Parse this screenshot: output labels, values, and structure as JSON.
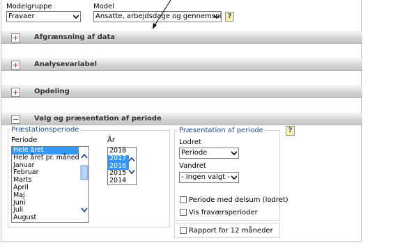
{
  "colors": {
    "accent": "#3399ff",
    "section_title": "#1f4e9a",
    "help_bg": "#fff1a8"
  },
  "top": {
    "modelgruppe_label": "Modelgruppe",
    "modelgruppe_value": "Fravaer",
    "model_label": "Model",
    "model_value": "Ansatte, arbejdsdage og gennemsnit",
    "help": "?"
  },
  "sections": [
    {
      "toggle": "+",
      "title": "Afgrænsning af data"
    },
    {
      "toggle": "+",
      "title": "Analysevariabel"
    },
    {
      "toggle": "+",
      "title": "Opdeling"
    },
    {
      "toggle": "−",
      "title": "Valg og præsentation af periode"
    }
  ],
  "periode_panel": {
    "group_title": "Præstationsperiode",
    "periode_label": "Periode",
    "periode_options": [
      "Hele året",
      "Hele året pr. måned",
      "Januar",
      "Februar",
      "Marts",
      "April",
      "Maj",
      "Juni",
      "Juli",
      "August"
    ],
    "periode_selected": [
      0
    ],
    "aar_label": "År",
    "aar_options": [
      "2018",
      "2017",
      "2016",
      "2015",
      "2014"
    ],
    "aar_selected": [
      1,
      2
    ]
  },
  "praesentation": {
    "group_title": "Præsentation af periode",
    "help": "?",
    "lodret_label": "Lodret",
    "lodret_value": "Periode",
    "vandret_label": "Vandret",
    "vandret_value": "- Ingen valgt -",
    "cb_delsum": "Periode med delsum (lodret)",
    "cb_fravaer": "Vis fraværsperioder",
    "cb_rapport": "Rapport for 12 måneder"
  }
}
